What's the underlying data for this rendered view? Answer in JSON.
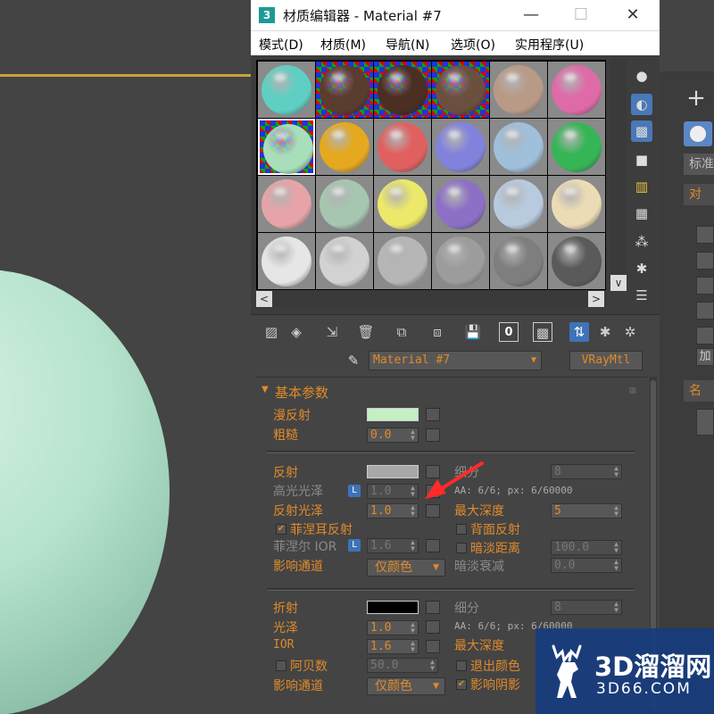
{
  "window": {
    "app_icon_label": "3",
    "title": "材质编辑器 - Material #7",
    "controls": {
      "minimize": "—",
      "maximize": "☐",
      "close": "✕"
    }
  },
  "menu": [
    "模式(D)",
    "材质(M)",
    "导航(N)",
    "选项(O)",
    "实用程序(U)"
  ],
  "slots": [
    {
      "color": "#5fcfc3",
      "checker": false,
      "selected": false
    },
    {
      "color": "#5a3d2e",
      "checker": true,
      "selected": false
    },
    {
      "color": "#4a2f22",
      "checker": true,
      "selected": false
    },
    {
      "color": "#6b5040",
      "checker": true,
      "selected": false
    },
    {
      "color": "#b89a86",
      "checker": false,
      "selected": false
    },
    {
      "color": "#df6aa8",
      "checker": false,
      "selected": false
    },
    {
      "color": "#a8dfba",
      "checker": true,
      "selected": true
    },
    {
      "color": "#e6a81e",
      "checker": false,
      "selected": false
    },
    {
      "color": "#e06060",
      "checker": false,
      "selected": false
    },
    {
      "color": "#8282dc",
      "checker": false,
      "selected": false
    },
    {
      "color": "#9fbfda",
      "checker": false,
      "selected": false
    },
    {
      "color": "#36b556",
      "checker": false,
      "selected": false
    },
    {
      "color": "#e6a4a8",
      "checker": false,
      "selected": false
    },
    {
      "color": "#a6c6b0",
      "checker": false,
      "selected": false
    },
    {
      "color": "#ece86a",
      "checker": false,
      "selected": false
    },
    {
      "color": "#8c70c6",
      "checker": false,
      "selected": false
    },
    {
      "color": "#b8cade",
      "checker": false,
      "selected": false
    },
    {
      "color": "#ecdcb6",
      "checker": false,
      "selected": false
    },
    {
      "color": "#e6e6e6",
      "checker": false,
      "selected": false
    },
    {
      "color": "#d2d2d2",
      "checker": false,
      "selected": false
    },
    {
      "color": "#b6b6b6",
      "checker": false,
      "selected": false
    },
    {
      "color": "#9c9c9c",
      "checker": false,
      "selected": false
    },
    {
      "color": "#7e7e7e",
      "checker": false,
      "selected": false
    },
    {
      "color": "#5a5a5a",
      "checker": false,
      "selected": false
    }
  ],
  "scroll_arrows": {
    "left": "<",
    "right": ">",
    "down": "∨"
  },
  "toolbar_box_label": "0",
  "material_row": {
    "name": "Material #7",
    "type": "VRayMtl"
  },
  "rollout": {
    "title": "基本参数"
  },
  "diffuse": {
    "label": "漫反射",
    "color": "#c4f0c4"
  },
  "roughness": {
    "label": "粗糙",
    "value": "0.0"
  },
  "reflect": {
    "label": "反射",
    "color": "#a8a8a8",
    "hilight_label": "高光光泽",
    "hilight_value": "1.0",
    "gloss_label": "反射光泽",
    "gloss_value": "1.0",
    "fresnel_label": "菲涅耳反射",
    "fresnel_ior_label": "菲涅尔 IOR",
    "fresnel_ior_value": "1.6",
    "affect_label": "影响通道",
    "affect_value": "仅颜色",
    "subdiv_label": "细分",
    "subdiv_value": "8",
    "aa_text": "AA: 6/6; px: 6/60000",
    "max_depth_label": "最大深度",
    "max_depth_value": "5",
    "back_label": "背面反射",
    "dim_label": "暗淡距离",
    "dim_value": "100.0",
    "dim_falloff_label": "暗淡衰减",
    "dim_falloff_value": "0.0",
    "l_badge": "L"
  },
  "refract": {
    "label": "折射",
    "color": "#000000",
    "gloss_label": "光泽",
    "gloss_value": "1.0",
    "ior_label": "IOR",
    "ior_value": "1.6",
    "abbe_label": "阿贝数",
    "abbe_value": "50.0",
    "affect_label": "影响通道",
    "affect_value": "仅颜色",
    "subdiv_label": "细分",
    "subdiv_value": "8",
    "aa_text": "AA: 6/6; px: 6/60000",
    "max_depth_label": "最大深度",
    "exit_label": "退出颜色",
    "shadow_label": "影响阴影"
  },
  "right_panel": {
    "plus": "+",
    "std": "标准",
    "head1": "对",
    "head2": "名",
    "btn_char": "加"
  },
  "watermark": {
    "title": "3D溜溜网",
    "url": "3D66.COM"
  }
}
